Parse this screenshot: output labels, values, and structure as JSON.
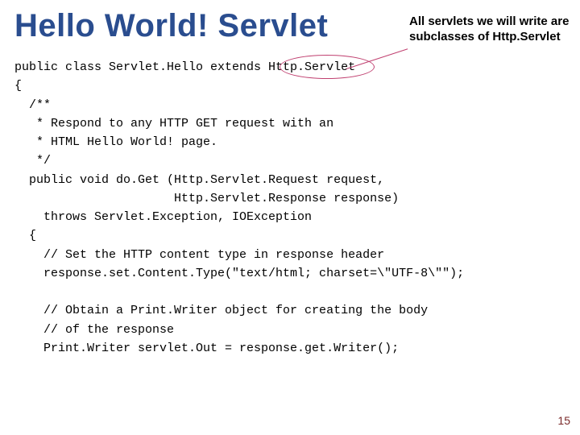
{
  "title": "Hello World! Servlet",
  "annotation": "All servlets we will write are subclasses of Http.Servlet",
  "code": "public class Servlet.Hello extends Http.Servlet\n{\n  /**\n   * Respond to any HTTP GET request with an\n   * HTML Hello World! page.\n   */\n  public void do.Get (Http.Servlet.Request request,\n                      Http.Servlet.Response response)\n    throws Servlet.Exception, IOException\n  {\n    // Set the HTTP content type in response header\n    response.set.Content.Type(\"text/html; charset=\\\"UTF-8\\\"\");\n\n    // Obtain a Print.Writer object for creating the body\n    // of the response\n    Print.Writer servlet.Out = response.get.Writer();",
  "page_number": "15"
}
